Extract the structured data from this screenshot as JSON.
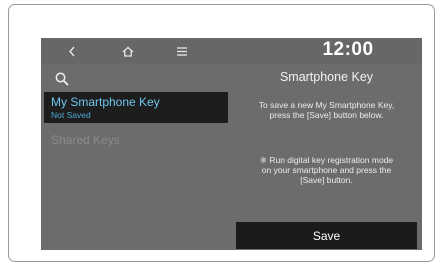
{
  "topbar": {
    "back_icon": "chevron-left-icon",
    "home_icon": "home-icon",
    "menu_icon": "menu-icon",
    "clock": "12:00"
  },
  "sidebar": {
    "search_icon": "search-icon",
    "items": [
      {
        "label": "My Smartphone Key",
        "status": "Not Saved",
        "selected": true
      },
      {
        "label": "Shared Keys",
        "selected": false
      }
    ]
  },
  "main": {
    "title": "Smartphone Key",
    "description_line1": "To save a new My Smartphone Key,",
    "description_line2": "press the [Save] button below.",
    "note_line1": "※ Run digital key registration mode",
    "note_line2": "on your smartphone and press the",
    "note_line3": "[Save] button.",
    "save_label": "Save"
  },
  "colors": {
    "screen_bg": "#6c6c6c",
    "selected_bg": "#1d1d1d",
    "selected_text": "#6ec7f0",
    "status_text": "#4aa9d6",
    "disabled_text": "#8b8b8b",
    "button_bg": "#1b1b1b"
  }
}
